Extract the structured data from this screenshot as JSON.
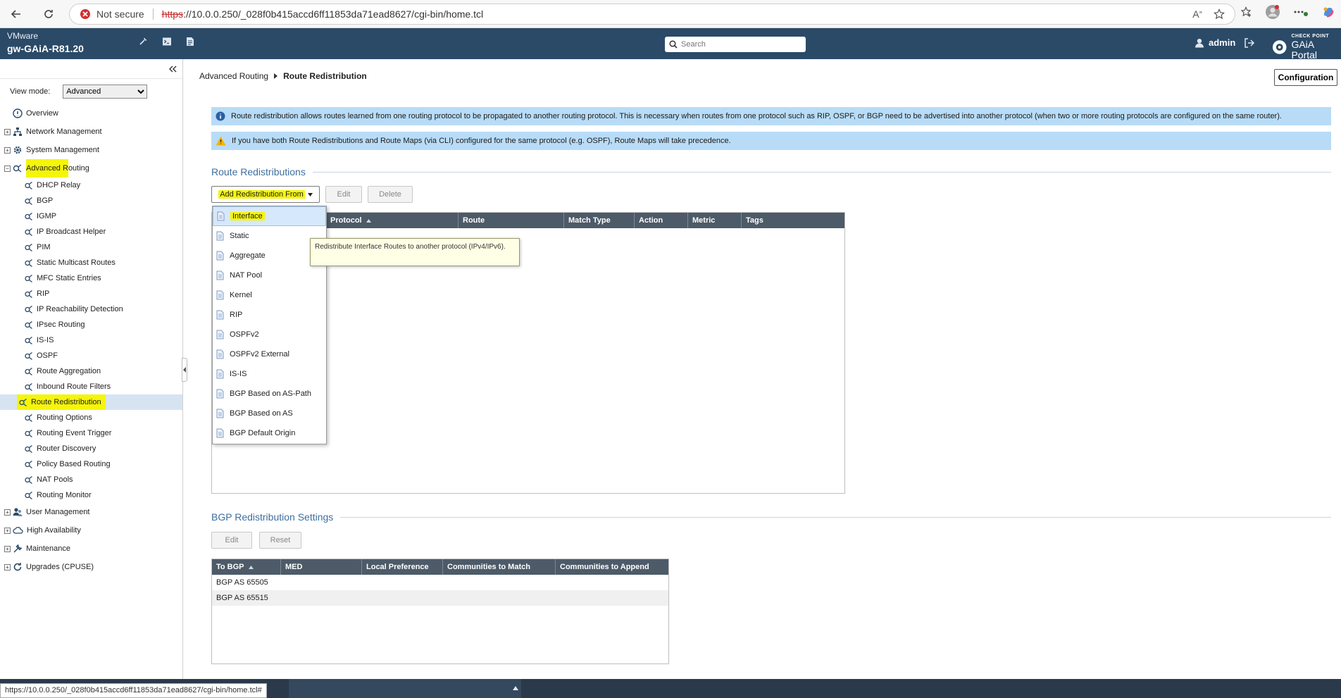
{
  "browser": {
    "not_secure": "Not secure",
    "url_scheme": "https",
    "url_rest": "://10.0.0.250/_028f0b415accd6ff11853da71ead8627/cgi-bin/home.tcl"
  },
  "header": {
    "vendor": "VMware",
    "hostname": "gw-GAiA-R81.20",
    "search_placeholder": "Search",
    "user": "admin",
    "logo_top": "CHECK POINT",
    "logo_bottom": "GAiA Portal"
  },
  "sidebar": {
    "view_mode_label": "View mode:",
    "view_mode_value": "Advanced",
    "overview": "Overview",
    "top_items": [
      "Network Management",
      "System Management",
      "Advanced Routing"
    ],
    "advanced_routing_parts": [
      "Advanced R",
      "outing"
    ],
    "sub_items": [
      "DHCP Relay",
      "BGP",
      "IGMP",
      "IP Broadcast Helper",
      "PIM",
      "Static Multicast Routes",
      "MFC Static Entries",
      "RIP",
      "IP Reachability Detection",
      "IPsec Routing",
      "IS-IS",
      "OSPF",
      "Route Aggregation",
      "Inbound Route Filters",
      "Route Redistribution",
      "Routing Options",
      "Routing Event Trigger",
      "Router Discovery",
      "Policy Based Routing",
      "NAT Pools",
      "Routing Monitor"
    ],
    "bottom_items": [
      "User Management",
      "High Availability",
      "Maintenance",
      "Upgrades (CPUSE)"
    ]
  },
  "main": {
    "breadcrumb_parent": "Advanced Routing",
    "breadcrumb_current": "Route Redistribution",
    "config_button": "Configuration",
    "info_text": "Route redistribution allows routes learned from one routing protocol to be propagated to another routing protocol. This is necessary when routes from one protocol such as RIP, OSPF, or BGP need to be advertised into another protocol (when two or more routing protocols are configured on the same router).",
    "warning_text": "If you have both Route Redistributions and Route Maps (via CLI) configured for the same protocol (e.g. OSPF), Route Maps will take precedence.",
    "redistributions_title": "Route Redistributions",
    "add_button": "Add Redistribution From",
    "edit_button": "Edit",
    "delete_button": "Delete",
    "redist_columns": [
      "To Protocol",
      "Route",
      "Match Type",
      "Action",
      "Metric",
      "Tags"
    ],
    "redist_col_visible": "Protocol",
    "bgp_title": "BGP Redistribution Settings",
    "bgp_edit": "Edit",
    "bgp_reset": "Reset",
    "bgp_columns": [
      "To BGP",
      "MED",
      "Local Preference",
      "Communities to Match",
      "Communities to Append"
    ],
    "bgp_rows": [
      "BGP AS 65505",
      "BGP AS 65515"
    ]
  },
  "dropdown": {
    "items": [
      "Interface",
      "Static",
      "Aggregate",
      "NAT Pool",
      "Kernel",
      "RIP",
      "OSPFv2",
      "OSPFv2 External",
      "IS-IS",
      "BGP Based on AS-Path",
      "BGP Based on AS",
      "BGP Default Origin"
    ],
    "tooltip": "Redistribute Interface Routes to another protocol (IPv4/IPv6)."
  },
  "status": {
    "url": "https://10.0.0.250/_028f0b415accd6ff11853da71ead8627/cgi-bin/home.tcl#"
  },
  "colors": {
    "header_bg": "#2b4a68",
    "info_bg": "#b8dcf7",
    "highlight": "#f5f50a",
    "section_title": "#3d6fa0"
  }
}
